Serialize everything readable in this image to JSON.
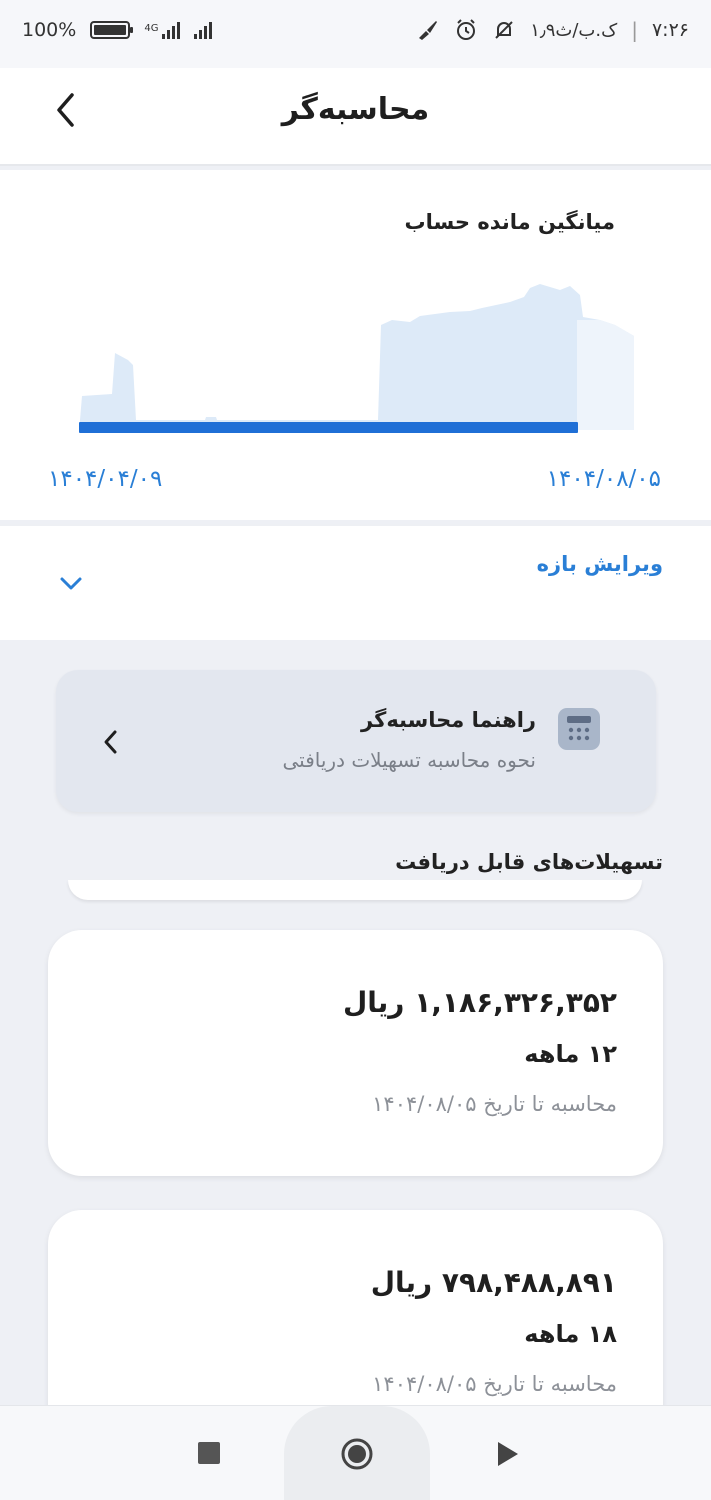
{
  "status_bar": {
    "time": "۷:۲۶",
    "speed": "۱٫۹ک.ب/ث",
    "battery_text": "100%",
    "network": "4G"
  },
  "header": {
    "title": "محاسبه‌گر",
    "back_icon": "chevron-left-icon"
  },
  "chart": {
    "title": "میانگین مانده حساب",
    "start_date": "۱۴۰۴/۰۴/۰۹",
    "end_date": "۱۴۰۴/۰۸/۰۵",
    "fill_color": "#ddeaf8",
    "highlight_color": "#1f6fd6",
    "selected_range": [
      0.0,
      0.87
    ]
  },
  "edit_range": {
    "label": "ویرایش بازه",
    "icon": "chevron-down-icon"
  },
  "guide": {
    "title": "راهنما محاسبه‌گر",
    "subtitle": "نحوه محاسبه تسهیلات دریافتی",
    "icon": "calculator-icon"
  },
  "loans_section": {
    "heading": "تسهیلات‌های قابل دریافت",
    "items": [
      {
        "amount": "۱,۱۸۶,۳۲۶,۳۵۲ ریال",
        "term": "۱۲ ماهه",
        "date_text": "محاسبه تا تاریخ ۱۴۰۴/۰۸/۰۵"
      },
      {
        "amount": "۷۹۸,۴۸۸,۸۹۱ ریال",
        "term": "۱۸ ماهه",
        "date_text": "محاسبه تا تاریخ ۱۴۰۴/۰۸/۰۵"
      }
    ]
  },
  "nav": {
    "stop_icon": "square-stop-icon",
    "home_icon": "circle-home-icon",
    "back_icon": "triangle-back-icon"
  },
  "colors": {
    "accent": "#2a7fd6",
    "background": "#eef0f5",
    "card": "#ffffff"
  }
}
